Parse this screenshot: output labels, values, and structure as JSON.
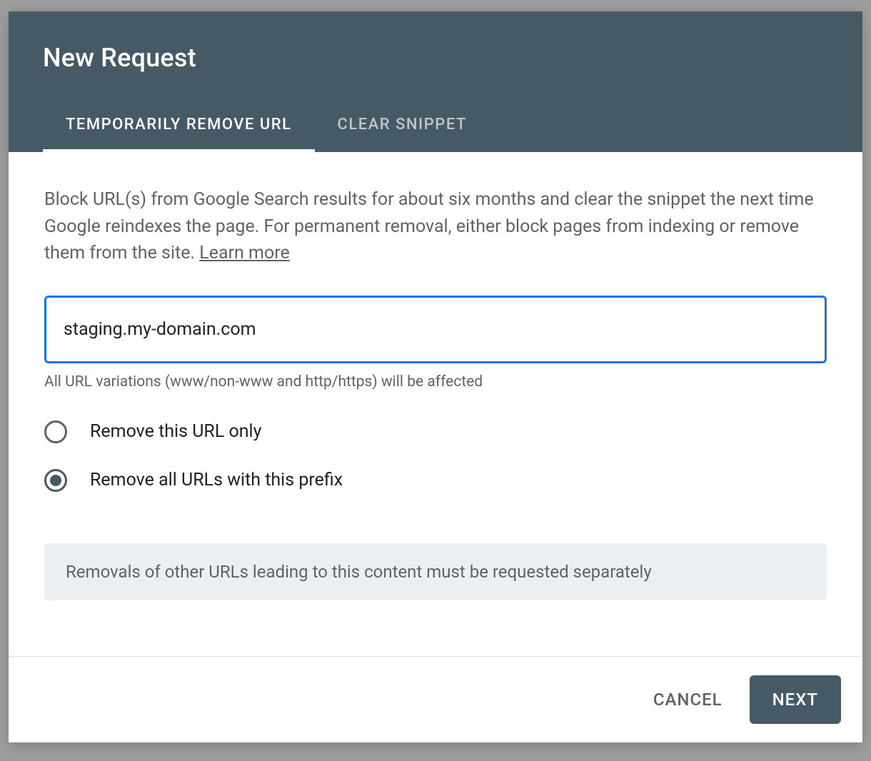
{
  "dialog": {
    "title": "New Request",
    "tabs": [
      {
        "label": "TEMPORARILY REMOVE URL",
        "active": true
      },
      {
        "label": "CLEAR SNIPPET",
        "active": false
      }
    ],
    "description_part1": "Block URL(s) from Google Search results for about six months and clear the snippet the next time Google reindexes the page. For permanent removal, either block pages from indexing or remove them from the site. ",
    "learn_more_label": "Learn more",
    "url_input_value": "staging.my-domain.com",
    "helper_text": "All URL variations (www/non-www and http/https) will be affected",
    "radio": {
      "option1": "Remove this URL only",
      "option2": "Remove all URLs with this prefix",
      "selected_index": 1
    },
    "info_box": "Removals of other URLs leading to this content must be requested separately",
    "buttons": {
      "cancel": "CANCEL",
      "next": "NEXT"
    }
  }
}
